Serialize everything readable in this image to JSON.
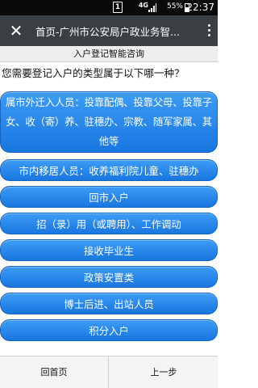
{
  "status_bar": {
    "sim_indicator": "1",
    "network": "4G",
    "battery_percent": "55%",
    "battery_level": 0.55,
    "time": "22:37"
  },
  "app_bar": {
    "title": "首页-广州市公安局户政业务智...",
    "close_icon": "close-icon",
    "more_icon": "more-vert-icon"
  },
  "page": {
    "header": "入户登记智能咨询",
    "question": "您需要登记入户的类型属于以下哪一种？"
  },
  "options": [
    {
      "label": "属市外迁入人员：投靠配偶、投靠父母、投靠子女、收（寄）养、驻穗办、宗教、随军家属、其他等"
    },
    {
      "label": "市内移居人员：收养福利院儿童、驻穗办"
    },
    {
      "label": "回市入户"
    },
    {
      "label": "招（录）用（或聘用）、工作调动"
    },
    {
      "label": "接收毕业生"
    },
    {
      "label": "政策安置类"
    },
    {
      "label": "博士后进、出站人员"
    },
    {
      "label": "积分入户"
    }
  ],
  "bottom_bar": {
    "home_label": "回首页",
    "back_label": "上一步"
  },
  "colors": {
    "button_top": "#3d9cf5",
    "button_bottom": "#1876e0",
    "app_bar": "#3a3f44",
    "status_bar": "#0a0a0a"
  }
}
